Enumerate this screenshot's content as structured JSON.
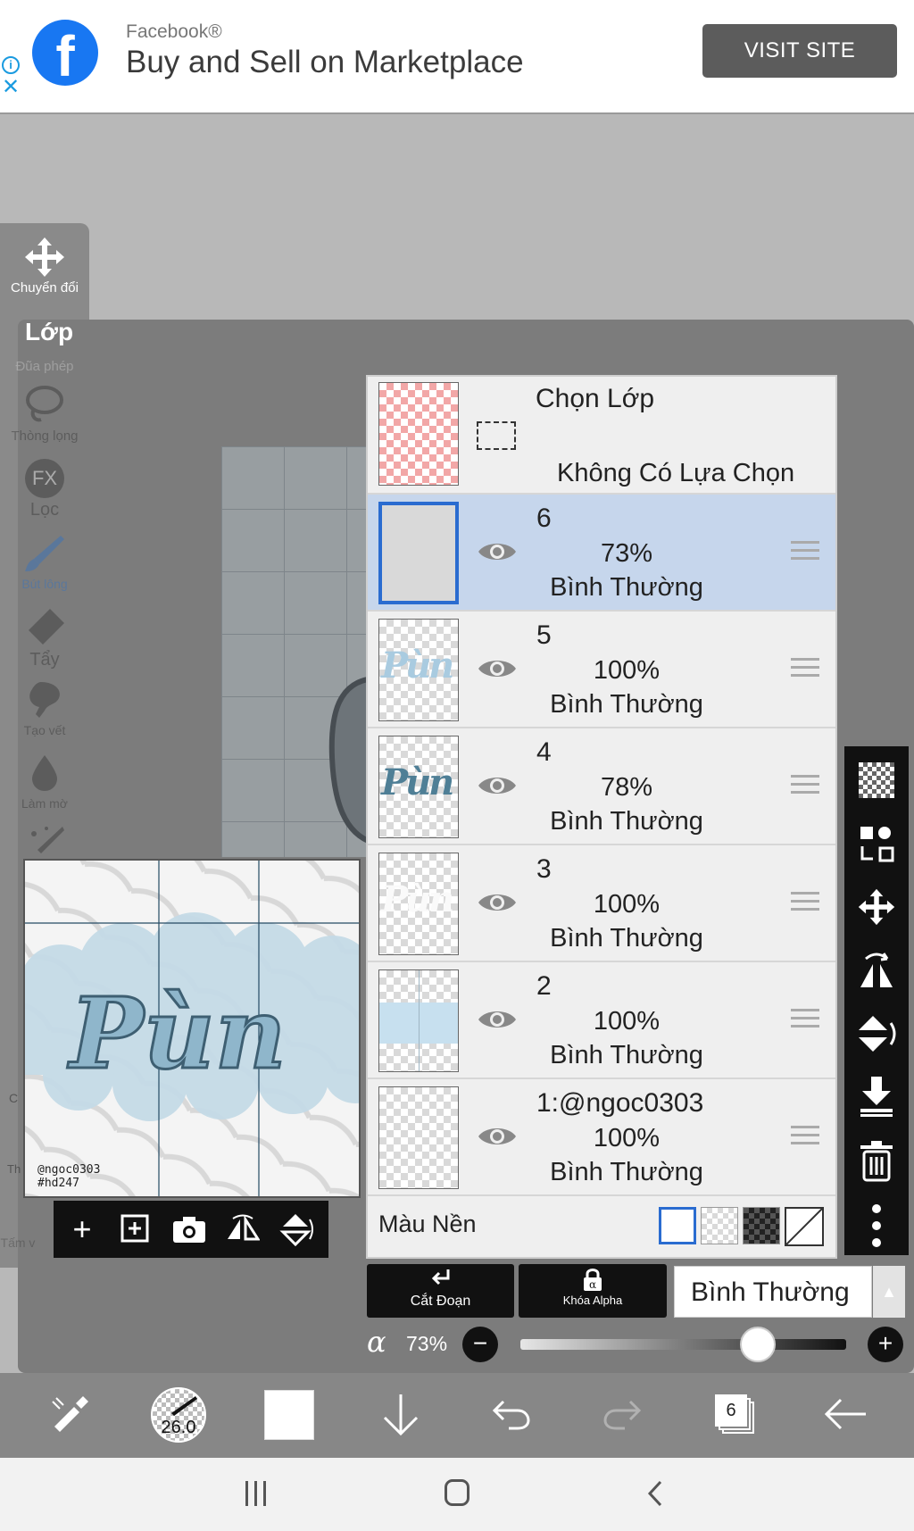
{
  "ad": {
    "brand": "Facebook®",
    "title": "Buy and Sell on Marketplace",
    "cta": "VISIT SITE",
    "logo_letter": "f",
    "info_icon": "i",
    "close_icon": "✕"
  },
  "left_toolbar": {
    "items": [
      {
        "label": "Chuyển đổi",
        "icon": "move-arrows-icon"
      },
      {
        "label": "Lớp",
        "icon": "layer-icon"
      },
      {
        "label": "Đũa phép",
        "icon": "magic-wand-icon"
      },
      {
        "label": "Thòng lọng",
        "icon": "lasso-icon"
      },
      {
        "label": "Lọc",
        "icon": "fx-icon"
      },
      {
        "label": "Bút lông",
        "icon": "brush-icon"
      },
      {
        "label": "Tẩy",
        "icon": "eraser-icon"
      },
      {
        "label": "Tạo vết",
        "icon": "smudge-icon"
      },
      {
        "label": "Làm mờ",
        "icon": "blur-drop-icon"
      },
      {
        "label": "Tấm v",
        "icon": "canvas-icon"
      }
    ],
    "fx_text": "FX",
    "edge_letters": [
      "C",
      "Th"
    ]
  },
  "preview": {
    "art_text": "Pùn",
    "watermark_line1": "@ngoc0303",
    "watermark_line2": "#hd247"
  },
  "layers": {
    "selection_row": {
      "title": "Chọn Lớp",
      "status": "Không Có Lựa Chọn"
    },
    "items": [
      {
        "name": "6",
        "opacity": "73%",
        "mode": "Bình Thường",
        "active": true
      },
      {
        "name": "5",
        "opacity": "100%",
        "mode": "Bình Thường",
        "active": false
      },
      {
        "name": "4",
        "opacity": "78%",
        "mode": "Bình Thường",
        "active": false
      },
      {
        "name": "3",
        "opacity": "100%",
        "mode": "Bình Thường",
        "active": false
      },
      {
        "name": "2",
        "opacity": "100%",
        "mode": "Bình Thường",
        "active": false
      },
      {
        "name": "1:@ngoc0303",
        "opacity": "100%",
        "mode": "Bình Thường",
        "active": false
      }
    ],
    "background_label": "Màu Nền"
  },
  "controls": {
    "clip_label": "Cắt Đoạn",
    "alpha_lock_label": "Khóa Alpha",
    "blend_mode": "Bình Thường",
    "alpha_symbol": "α",
    "opacity_value": "73%",
    "opacity_fraction": 0.73,
    "minus": "−",
    "plus": "+"
  },
  "bottom_bar": {
    "brush_size": "26.0",
    "layer_count": "6"
  },
  "colors": {
    "accent_blue": "#2a6cd0",
    "active_row": "#c6d6ec",
    "facebook_blue": "#1877f2"
  }
}
